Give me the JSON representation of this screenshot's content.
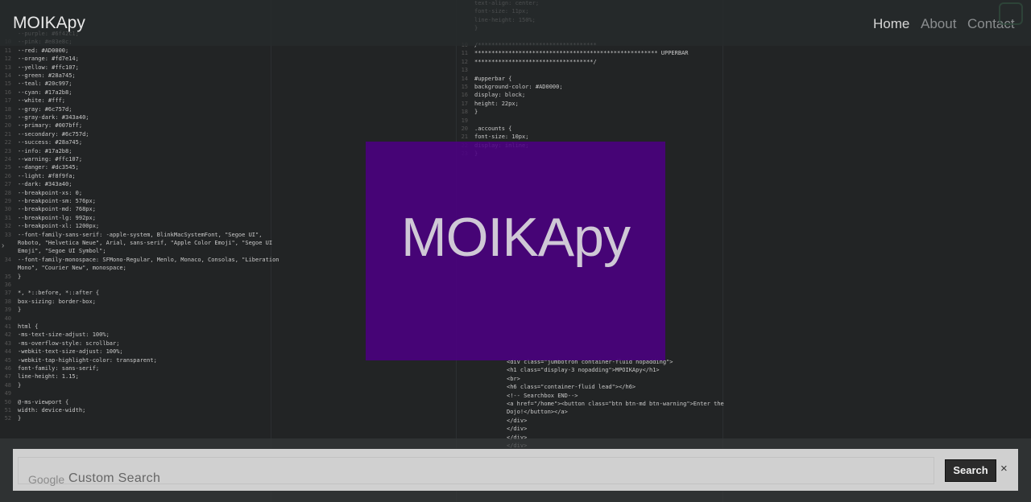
{
  "navbar": {
    "brand": "MOIKApy",
    "links": [
      "Home",
      "About",
      "Contact"
    ]
  },
  "hero": {
    "title": "MOIKApy"
  },
  "search": {
    "google_mark": "Google",
    "placeholder": "Custom Search",
    "button_label": "Search",
    "close_glyph": "×"
  },
  "editor": {
    "left_lines": [
      {
        "n": "",
        "t": "--purple: #6f42c1;"
      },
      {
        "n": "10",
        "t": "--pink: #e83e8c;"
      },
      {
        "n": "11",
        "t": "--red: #AD0000;"
      },
      {
        "n": "12",
        "t": "--orange: #fd7e14;"
      },
      {
        "n": "13",
        "t": "--yellow: #ffc107;"
      },
      {
        "n": "14",
        "t": "--green: #28a745;"
      },
      {
        "n": "15",
        "t": "--teal: #20c997;"
      },
      {
        "n": "16",
        "t": "--cyan: #17a2b8;"
      },
      {
        "n": "17",
        "t": "--white: #fff;"
      },
      {
        "n": "18",
        "t": "--gray: #6c757d;"
      },
      {
        "n": "19",
        "t": "--gray-dark: #343a40;"
      },
      {
        "n": "20",
        "t": "--primary: #007bff;"
      },
      {
        "n": "21",
        "t": "--secondary: #6c757d;"
      },
      {
        "n": "22",
        "t": "--success: #28a745;"
      },
      {
        "n": "23",
        "t": "--info: #17a2b8;"
      },
      {
        "n": "24",
        "t": "--warning: #ffc107;"
      },
      {
        "n": "25",
        "t": "--danger: #dc3545;"
      },
      {
        "n": "26",
        "t": "--light: #f8f9fa;"
      },
      {
        "n": "27",
        "t": "--dark: #343a40;"
      },
      {
        "n": "28",
        "t": "--breakpoint-xs: 0;"
      },
      {
        "n": "29",
        "t": "--breakpoint-sm: 576px;"
      },
      {
        "n": "30",
        "t": "--breakpoint-md: 768px;"
      },
      {
        "n": "31",
        "t": "--breakpoint-lg: 992px;"
      },
      {
        "n": "32",
        "t": "--breakpoint-xl: 1200px;"
      },
      {
        "n": "33",
        "t": "--font-family-sans-serif: -apple-system, BlinkMacSystemFont, \"Segoe UI\","
      },
      {
        "n": "",
        "t": "Roboto, \"Helvetica Neue\", Arial, sans-serif, \"Apple Color Emoji\", \"Segoe UI"
      },
      {
        "n": "",
        "t": "Emoji\", \"Segoe UI Symbol\";"
      },
      {
        "n": "34",
        "t": "--font-family-monospace: SFMono-Regular, Menlo, Monaco, Consolas, \"Liberation"
      },
      {
        "n": "",
        "t": "Mono\", \"Courier New\", monospace;"
      },
      {
        "n": "35",
        "t": "}"
      },
      {
        "n": "36",
        "t": ""
      },
      {
        "n": "37",
        "t": "*, *::before, *::after {"
      },
      {
        "n": "38",
        "t": "box-sizing: border-box;"
      },
      {
        "n": "39",
        "t": "}"
      },
      {
        "n": "40",
        "t": ""
      },
      {
        "n": "41",
        "t": "html {"
      },
      {
        "n": "42",
        "t": "-ms-text-size-adjust: 100%;"
      },
      {
        "n": "43",
        "t": "-ms-overflow-style: scrollbar;"
      },
      {
        "n": "44",
        "t": "-webkit-text-size-adjust: 100%;"
      },
      {
        "n": "45",
        "t": "-webkit-tap-highlight-color: transparent;"
      },
      {
        "n": "46",
        "t": "font-family: sans-serif;"
      },
      {
        "n": "47",
        "t": "line-height: 1.15;"
      },
      {
        "n": "48",
        "t": "}"
      },
      {
        "n": "49",
        "t": ""
      },
      {
        "n": "50",
        "t": "@-ms-viewport {"
      },
      {
        "n": "51",
        "t": "width: device-width;"
      },
      {
        "n": "52",
        "t": "}"
      }
    ],
    "right_lines": [
      {
        "n": "",
        "t": "text-align: center;"
      },
      {
        "n": "",
        "t": "font-size: 11px;"
      },
      {
        "n": "",
        "t": "line-height: 150%;"
      },
      {
        "n": "",
        "t": "}"
      },
      {
        "n": "",
        "t": ""
      },
      {
        "n": "10",
        "t": "/***********************************"
      },
      {
        "n": "11",
        "t": "****************************************************** UPPERBAR"
      },
      {
        "n": "12",
        "t": "***********************************/"
      },
      {
        "n": "13",
        "t": ""
      },
      {
        "n": "14",
        "t": "#upperbar {"
      },
      {
        "n": "15",
        "t": "background-color: #AD0000;"
      },
      {
        "n": "16",
        "t": "display: block;"
      },
      {
        "n": "17",
        "t": "height: 22px;"
      },
      {
        "n": "18",
        "t": "}"
      },
      {
        "n": "19",
        "t": ""
      },
      {
        "n": "20",
        "t": ".accounts {"
      },
      {
        "n": "21",
        "t": "font-size: 10px;"
      },
      {
        "n": "22",
        "t": "display: inline;"
      },
      {
        "n": "23",
        "t": "}"
      }
    ],
    "right_lines_lower": [
      {
        "n": "",
        "t": "<div class=\"jumbotron container-fluid nopadding\">"
      },
      {
        "n": "",
        "t": "<h1 class=\"display-3 nopadding\">MPOIKApy</h1>"
      },
      {
        "n": "",
        "t": "<br>"
      },
      {
        "n": "",
        "t": "<h6 class=\"container-fluid lead\"></h6>"
      },
      {
        "n": "",
        "t": "<!-- Searchbox END-->"
      },
      {
        "n": "",
        "t": "<a href=\"/home\"><button class=\"btn btn-md btn-warning\">Enter the"
      },
      {
        "n": "",
        "t": "Dojo!</button></a>"
      },
      {
        "n": "",
        "t": "</div>"
      },
      {
        "n": "",
        "t": "</div>"
      },
      {
        "n": "",
        "t": "</div>"
      },
      {
        "n": "",
        "t": "</div>"
      }
    ]
  },
  "colors": {
    "accent_purple": "#4b0082",
    "nav_bg": "#262a2c",
    "code_bg": "#222425",
    "search_bg": "#d0d0d0",
    "button_bg": "#2b2b2b"
  }
}
